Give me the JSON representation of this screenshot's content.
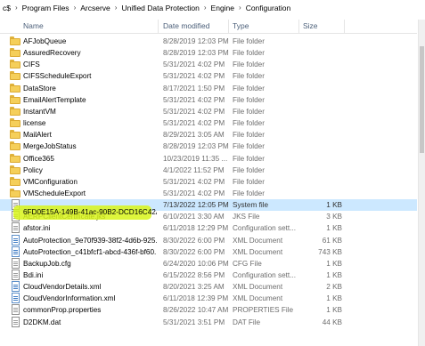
{
  "breadcrumb": {
    "items": [
      "c$",
      "Program Files",
      "Arcserve",
      "Unified Data Protection",
      "Engine",
      "Configuration"
    ],
    "separator": "›"
  },
  "columns": {
    "name": "Name",
    "date": "Date modified",
    "type": "Type",
    "size": "Size"
  },
  "files": [
    {
      "name": "AFJobQueue",
      "date": "8/28/2019 12:03 PM",
      "type": "File folder",
      "size": "",
      "icon": "folder-icon"
    },
    {
      "name": "AssuredRecovery",
      "date": "8/28/2019 12:03 PM",
      "type": "File folder",
      "size": "",
      "icon": "folder-icon"
    },
    {
      "name": "CIFS",
      "date": "5/31/2021 4:02 PM",
      "type": "File folder",
      "size": "",
      "icon": "folder-icon"
    },
    {
      "name": "CIFSScheduleExport",
      "date": "5/31/2021 4:02 PM",
      "type": "File folder",
      "size": "",
      "icon": "folder-icon"
    },
    {
      "name": "DataStore",
      "date": "8/17/2021 1:50 PM",
      "type": "File folder",
      "size": "",
      "icon": "folder-icon"
    },
    {
      "name": "EmailAlertTemplate",
      "date": "5/31/2021 4:02 PM",
      "type": "File folder",
      "size": "",
      "icon": "folder-icon"
    },
    {
      "name": "InstantVM",
      "date": "5/31/2021 4:02 PM",
      "type": "File folder",
      "size": "",
      "icon": "folder-icon"
    },
    {
      "name": "license",
      "date": "5/31/2021 4:02 PM",
      "type": "File folder",
      "size": "",
      "icon": "folder-icon"
    },
    {
      "name": "MailAlert",
      "date": "8/29/2021 3:05 AM",
      "type": "File folder",
      "size": "",
      "icon": "folder-icon"
    },
    {
      "name": "MergeJobStatus",
      "date": "8/28/2019 12:03 PM",
      "type": "File folder",
      "size": "",
      "icon": "folder-icon"
    },
    {
      "name": "Office365",
      "date": "10/23/2019 11:35 ...",
      "type": "File folder",
      "size": "",
      "icon": "folder-icon"
    },
    {
      "name": "Policy",
      "date": "4/1/2022 11:52 PM",
      "type": "File folder",
      "size": "",
      "icon": "folder-icon"
    },
    {
      "name": "VMConfiguration",
      "date": "5/31/2021 4:02 PM",
      "type": "File folder",
      "size": "",
      "icon": "folder-icon"
    },
    {
      "name": "VMScheduleExport",
      "date": "5/31/2021 4:02 PM",
      "type": "File folder",
      "size": "",
      "icon": "folder-icon"
    },
    {
      "name": "6FD0E15A-149B-41ac-90B2-DCD16C42A...",
      "date": "7/13/2022 12:05 PM",
      "type": "System file",
      "size": "1 KB",
      "icon": "file-icon",
      "selected": true
    },
    {
      "name": "AERPClientCertificate.jks",
      "date": "6/10/2021 3:30 AM",
      "type": "JKS File",
      "size": "3 KB",
      "icon": "file-icon"
    },
    {
      "name": "afstor.ini",
      "date": "6/11/2018 12:29 PM",
      "type": "Configuration sett...",
      "size": "1 KB",
      "icon": "file-icon"
    },
    {
      "name": "AutoProtection_9e70f939-38f2-4d6b-925...",
      "date": "8/30/2022 6:00 PM",
      "type": "XML Document",
      "size": "61 KB",
      "icon": "xml-icon"
    },
    {
      "name": "AutoProtection_c41bfcf1-abcd-436f-bf60...",
      "date": "8/30/2022 6:00 PM",
      "type": "XML Document",
      "size": "743 KB",
      "icon": "xml-icon"
    },
    {
      "name": "BackupJob.cfg",
      "date": "6/24/2020 10:06 PM",
      "type": "CFG File",
      "size": "1 KB",
      "icon": "file-icon"
    },
    {
      "name": "Bdi.ini",
      "date": "6/15/2022 8:56 PM",
      "type": "Configuration sett...",
      "size": "1 KB",
      "icon": "file-icon"
    },
    {
      "name": "CloudVendorDetails.xml",
      "date": "8/20/2021 3:25 AM",
      "type": "XML Document",
      "size": "2 KB",
      "icon": "xml-icon"
    },
    {
      "name": "CloudVendorInformation.xml",
      "date": "6/11/2018 12:39 PM",
      "type": "XML Document",
      "size": "1 KB",
      "icon": "xml-icon"
    },
    {
      "name": "commonProp.properties",
      "date": "8/26/2022 10:47 AM",
      "type": "PROPERTIES File",
      "size": "1 KB",
      "icon": "file-icon"
    },
    {
      "name": "D2DKM.dat",
      "date": "5/31/2021 3:51 PM",
      "type": "DAT File",
      "size": "44 KB",
      "icon": "file-icon"
    }
  ]
}
